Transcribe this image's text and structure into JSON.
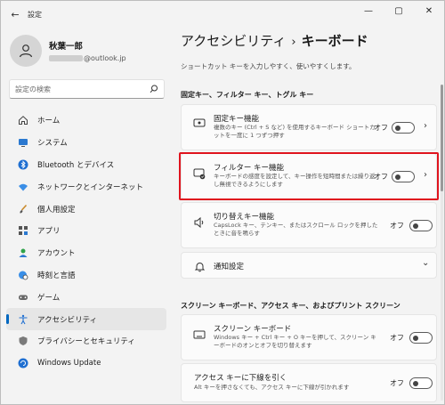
{
  "window": {
    "app_title": "設定",
    "back": "←",
    "minimize": "—",
    "maximize": "▢",
    "close": "✕"
  },
  "profile": {
    "name": "秋葉一郎",
    "email_domain": "@outlook.jp"
  },
  "search": {
    "placeholder": "設定の検索"
  },
  "nav": [
    {
      "label": "ホーム",
      "icon": "home-icon"
    },
    {
      "label": "システム",
      "icon": "monitor-icon"
    },
    {
      "label": "Bluetooth とデバイス",
      "icon": "bluetooth-icon"
    },
    {
      "label": "ネットワークとインターネット",
      "icon": "wifi-icon"
    },
    {
      "label": "個人用設定",
      "icon": "brush-icon"
    },
    {
      "label": "アプリ",
      "icon": "apps-icon"
    },
    {
      "label": "アカウント",
      "icon": "account-icon"
    },
    {
      "label": "時刻と言語",
      "icon": "globe-clock-icon"
    },
    {
      "label": "ゲーム",
      "icon": "gamepad-icon"
    },
    {
      "label": "アクセシビリティ",
      "icon": "accessibility-icon",
      "active": true
    },
    {
      "label": "プライバシーとセキュリティ",
      "icon": "shield-icon"
    },
    {
      "label": "Windows Update",
      "icon": "update-icon"
    }
  ],
  "main": {
    "breadcrumb_parent": "アクセシビリティ",
    "breadcrumb_sep": "›",
    "breadcrumb_current": "キーボード",
    "subtitle": "ショートカット キーを入力しやすく、使いやすくします。",
    "section1": "固定キー、フィルター キー、トグル キー",
    "section2": "スクリーン キーボード、アクセス キー、およびプリント スクリーン",
    "cards": [
      {
        "title": "固定キー機能",
        "desc": "複数のキー (Ctrl + S など) を使用するキーボード ショートカットを一度に 1 つずつ押す",
        "state": "オフ",
        "chevron": "›",
        "icon": "sticky-keys-icon"
      },
      {
        "title": "フィルター キー機能",
        "desc": "キーボードの感度を設定して、キー操作を短時間または繰り返し無視できるようにします",
        "state": "オフ",
        "chevron": "›",
        "icon": "filter-keys-icon"
      },
      {
        "title": "切り替えキー機能",
        "desc": "CapsLock キー、テンキー、またはスクロール ロックを押したときに音を鳴らす",
        "state": "オフ",
        "icon": "speaker-icon"
      },
      {
        "title": "通知設定",
        "chevron": "⌄",
        "icon": "bell-icon"
      },
      {
        "title": "スクリーン キーボード",
        "desc": "Windows キー + Ctrl キー + O キーを押して、スクリーン キーボードのオンとオフを切り替えます",
        "state": "オフ",
        "icon": "keyboard-icon"
      },
      {
        "title": "アクセス キーに下線を引く",
        "desc": "Alt キーを押さなくても、アクセス キーに下線が引かれます",
        "state": "オフ",
        "icon": "underline-icon"
      }
    ]
  }
}
